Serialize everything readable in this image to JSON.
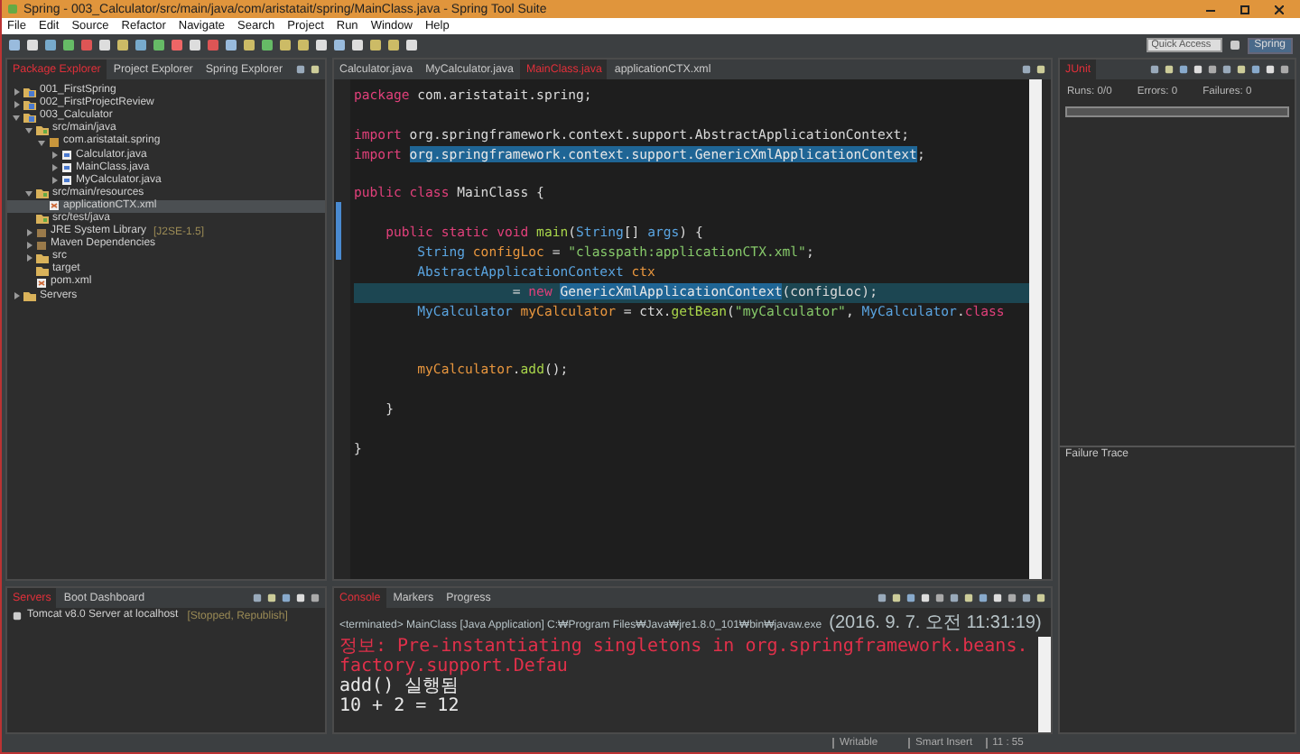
{
  "window": {
    "title": "Spring - 003_Calculator/src/main/java/com/aristatait/spring/MainClass.java - Spring Tool Suite"
  },
  "menu": [
    "File",
    "Edit",
    "Source",
    "Refactor",
    "Navigate",
    "Search",
    "Project",
    "Run",
    "Window",
    "Help"
  ],
  "toolbar": {
    "quick_access": {
      "placeholder": "Quick Access"
    },
    "perspective": {
      "label": "Spring",
      "selected": true
    }
  },
  "explorer": {
    "tabs": [
      {
        "label": "Package Explorer",
        "selected": true
      },
      {
        "label": "Project Explorer",
        "selected": false
      },
      {
        "label": "Spring Explorer",
        "selected": false
      }
    ],
    "tree": [
      {
        "label": "001_FirstSpring",
        "kind": "project",
        "expanded": false,
        "selected": false
      },
      {
        "label": "002_FirstProjectReview",
        "kind": "project",
        "expanded": false,
        "selected": false
      },
      {
        "label": "003_Calculator",
        "kind": "project",
        "expanded": true,
        "selected": false,
        "children": [
          {
            "label": "src/main/java",
            "kind": "folder",
            "expanded": true,
            "selected": false,
            "children": [
              {
                "label": "com.aristatait.spring",
                "kind": "package",
                "expanded": true,
                "selected": false,
                "children": [
                  {
                    "label": "Calculator.java",
                    "kind": "java",
                    "expanded": false,
                    "selected": false
                  },
                  {
                    "label": "MainClass.java",
                    "kind": "java",
                    "expanded": false,
                    "selected": false
                  },
                  {
                    "label": "MyCalculator.java",
                    "kind": "java",
                    "expanded": false,
                    "selected": false
                  }
                ]
              }
            ]
          },
          {
            "label": "src/main/resources",
            "kind": "folder",
            "expanded": true,
            "selected": false,
            "children": [
              {
                "label": "applicationCTX.xml",
                "kind": "xml",
                "selected": true
              }
            ]
          },
          {
            "label": "src/test/java",
            "kind": "folder",
            "selected": false
          },
          {
            "label": "JRE System Library",
            "decoration": "[J2SE-1.5]",
            "kind": "library",
            "expanded": false,
            "selected": false
          },
          {
            "label": "Maven Dependencies",
            "kind": "library",
            "expanded": false,
            "selected": false
          },
          {
            "label": "src",
            "kind": "plainfolder",
            "expanded": false,
            "selected": false
          },
          {
            "label": "target",
            "kind": "plainfolder",
            "selected": false
          },
          {
            "label": "pom.xml",
            "kind": "xml",
            "selected": false
          }
        ]
      },
      {
        "label": "Servers",
        "kind": "plainfolder",
        "expanded": false,
        "selected": false
      }
    ]
  },
  "editor": {
    "tabs": [
      {
        "label": "Calculator.java",
        "selected": false
      },
      {
        "label": "MyCalculator.java",
        "selected": false
      },
      {
        "label": "MainClass.java",
        "selected": true
      },
      {
        "label": "applicationCTX.xml",
        "selected": false
      }
    ],
    "lines": [
      {
        "kind": "code",
        "current": false,
        "tokens": [
          {
            "t": "package ",
            "kind": "kw"
          },
          {
            "t": "com.aristatait.spring;",
            "kind": "plain"
          }
        ]
      },
      {
        "kind": "blank"
      },
      {
        "kind": "code",
        "current": false,
        "tokens": [
          {
            "t": "import ",
            "kind": "kw"
          },
          {
            "t": "org.springframework.context.support.AbstractApplicationContext;",
            "kind": "plain"
          }
        ]
      },
      {
        "kind": "code",
        "current": false,
        "tokens": [
          {
            "t": "import ",
            "kind": "kw"
          },
          {
            "t": "org.springframework.context.support.GenericXmlApplicationContext",
            "kind": "mark"
          },
          {
            "t": ";",
            "kind": "plain"
          }
        ]
      },
      {
        "kind": "blank"
      },
      {
        "kind": "code",
        "current": false,
        "tokens": [
          {
            "t": "public class ",
            "kind": "kw"
          },
          {
            "t": "MainClass {",
            "kind": "plain"
          }
        ]
      },
      {
        "kind": "blank"
      },
      {
        "kind": "code",
        "current": false,
        "tokens": [
          {
            "t": "    public static void ",
            "kind": "kw"
          },
          {
            "t": "main",
            "kind": "method"
          },
          {
            "t": "(",
            "kind": "plain"
          },
          {
            "t": "String",
            "kind": "type"
          },
          {
            "t": "[] ",
            "kind": "plain"
          },
          {
            "t": "args",
            "kind": "type"
          },
          {
            "t": ") {",
            "kind": "plain"
          }
        ]
      },
      {
        "kind": "code",
        "current": false,
        "tokens": [
          {
            "t": "        String ",
            "kind": "type"
          },
          {
            "t": "configLoc",
            "kind": "var"
          },
          {
            "t": " = ",
            "kind": "plain"
          },
          {
            "t": "\"classpath:applicationCTX.xml\"",
            "kind": "str"
          },
          {
            "t": ";",
            "kind": "plain"
          }
        ]
      },
      {
        "kind": "code",
        "current": false,
        "tokens": [
          {
            "t": "        AbstractApplicationContext ",
            "kind": "type"
          },
          {
            "t": "ctx",
            "kind": "var"
          }
        ]
      },
      {
        "kind": "code",
        "current": true,
        "tokens": [
          {
            "t": "                    = ",
            "kind": "plain"
          },
          {
            "t": "new ",
            "kind": "kw"
          },
          {
            "t": "GenericXmlApplicationContext",
            "kind": "mark"
          },
          {
            "t": "(configLoc);",
            "kind": "plain"
          }
        ]
      },
      {
        "kind": "code",
        "current": false,
        "tokens": [
          {
            "t": "        MyCalculator ",
            "kind": "type"
          },
          {
            "t": "myCalculator",
            "kind": "var"
          },
          {
            "t": " = ctx.",
            "kind": "plain"
          },
          {
            "t": "getBean",
            "kind": "method"
          },
          {
            "t": "(",
            "kind": "plain"
          },
          {
            "t": "\"myCalculator\"",
            "kind": "str"
          },
          {
            "t": ", ",
            "kind": "plain"
          },
          {
            "t": "MyCalculator",
            "kind": "type"
          },
          {
            "t": ".",
            "kind": "plain"
          },
          {
            "t": "class",
            "kind": "kw"
          }
        ]
      },
      {
        "kind": "blank"
      },
      {
        "kind": "blank"
      },
      {
        "kind": "code",
        "current": false,
        "tokens": [
          {
            "t": "        myCalculator",
            "kind": "var"
          },
          {
            "t": ".",
            "kind": "plain"
          },
          {
            "t": "add",
            "kind": "method"
          },
          {
            "t": "();",
            "kind": "plain"
          }
        ]
      },
      {
        "kind": "blank"
      },
      {
        "kind": "code",
        "current": false,
        "tokens": [
          {
            "t": "    }",
            "kind": "plain"
          }
        ]
      },
      {
        "kind": "blank"
      },
      {
        "kind": "code",
        "current": false,
        "tokens": [
          {
            "t": "}",
            "kind": "plain"
          }
        ]
      }
    ]
  },
  "junit": {
    "tabs": [
      {
        "label": "JUnit",
        "selected": true
      }
    ],
    "runs": {
      "label": "Runs:",
      "value": "0/0"
    },
    "errors": {
      "label": "Errors:",
      "value": "0"
    },
    "failures": {
      "label": "Failures:",
      "value": "0"
    },
    "level": 0,
    "failure_trace": "Failure Trace"
  },
  "servers": {
    "tabs": [
      {
        "label": "Servers",
        "selected": true
      },
      {
        "label": "Boot Dashboard",
        "selected": false
      }
    ],
    "rows": [
      {
        "label": "Tomcat v8.0 Server at localhost",
        "status": "[Stopped, Republish]"
      }
    ]
  },
  "console": {
    "tabs": [
      {
        "label": "Console",
        "selected": true
      },
      {
        "label": "Markers",
        "selected": false
      },
      {
        "label": "Progress",
        "selected": false
      }
    ],
    "launch": "<terminated> MainClass [Java Application] C:₩Program Files₩Java₩jre1.8.0_101₩bin₩javaw.exe",
    "time": "(2016. 9. 7. 오전 11:31:19)",
    "lines": [
      {
        "text": "정보: Pre-instantiating singletons in org.springframework.beans.factory.support.Defau",
        "kind": "stderr"
      },
      {
        "text": "add() 실행됨",
        "kind": "stdout"
      },
      {
        "text": "10 + 2 = 12",
        "kind": "stdout"
      }
    ]
  },
  "status_bar": [
    "Writable",
    "Smart Insert",
    "11 : 55"
  ]
}
